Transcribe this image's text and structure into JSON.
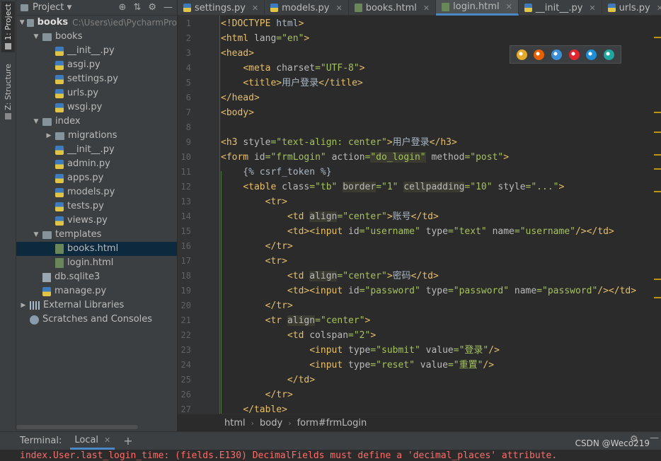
{
  "toolstrip": {
    "project_tab": "1: Project",
    "structure_tab": "Z: Structure"
  },
  "project_panel": {
    "title": "Project",
    "tree": [
      {
        "label": "books",
        "path": "C:\\Users\\ied\\PycharmPro",
        "type": "folder",
        "depth": 0,
        "expanded": true,
        "bold": true
      },
      {
        "label": "books",
        "type": "folder",
        "depth": 1,
        "expanded": true
      },
      {
        "label": "__init__.py",
        "type": "py",
        "depth": 2
      },
      {
        "label": "asgi.py",
        "type": "py",
        "depth": 2
      },
      {
        "label": "settings.py",
        "type": "py",
        "depth": 2
      },
      {
        "label": "urls.py",
        "type": "py",
        "depth": 2
      },
      {
        "label": "wsgi.py",
        "type": "py",
        "depth": 2
      },
      {
        "label": "index",
        "type": "folder",
        "depth": 1,
        "expanded": true
      },
      {
        "label": "migrations",
        "type": "folder",
        "depth": 2,
        "expanded": false
      },
      {
        "label": "__init__.py",
        "type": "py",
        "depth": 2
      },
      {
        "label": "admin.py",
        "type": "py",
        "depth": 2
      },
      {
        "label": "apps.py",
        "type": "py",
        "depth": 2
      },
      {
        "label": "models.py",
        "type": "py",
        "depth": 2
      },
      {
        "label": "tests.py",
        "type": "py",
        "depth": 2
      },
      {
        "label": "views.py",
        "type": "py",
        "depth": 2
      },
      {
        "label": "templates",
        "type": "folder",
        "depth": 1,
        "expanded": true
      },
      {
        "label": "books.html",
        "type": "html",
        "depth": 2,
        "selected": true
      },
      {
        "label": "login.html",
        "type": "html",
        "depth": 2
      },
      {
        "label": "db.sqlite3",
        "type": "db",
        "depth": 1
      },
      {
        "label": "manage.py",
        "type": "py",
        "depth": 1
      },
      {
        "label": "External Libraries",
        "type": "lib",
        "depth": 0,
        "expanded": false
      },
      {
        "label": "Scratches and Consoles",
        "type": "scratch",
        "depth": 0
      }
    ]
  },
  "editor_tabs": [
    {
      "label": "settings.py",
      "type": "py"
    },
    {
      "label": "models.py",
      "type": "py"
    },
    {
      "label": "books.html",
      "type": "html"
    },
    {
      "label": "login.html",
      "type": "html",
      "active": true
    },
    {
      "label": "__init__.py",
      "type": "py"
    },
    {
      "label": "urls.py",
      "type": "py"
    }
  ],
  "line_numbers": [
    "1",
    "2",
    "3",
    "4",
    "5",
    "6",
    "7",
    "8",
    "9",
    "10",
    "11",
    "12",
    "13",
    "14",
    "15",
    "16",
    "17",
    "18",
    "19",
    "20",
    "21",
    "22",
    "23",
    "24",
    "25",
    "26",
    "27"
  ],
  "code_lines": [
    "<!DOCTYPE html>",
    "<html lang=\"en\">",
    "<head>",
    "    <meta charset=\"UTF-8\">",
    "    <title>用户登录</title>",
    "</head>",
    "<body>",
    "",
    "<h3 style=\"text-align: center\">用户登录</h3>",
    "<form id=\"frmLogin\" action=\"do_login\" method=\"post\">",
    "    {% csrf_token %}",
    "    <table class=\"tb\" border=\"1\" cellpadding=\"10\" style=\"...\">",
    "        <tr>",
    "            <td align=\"center\">账号</td>",
    "            <td><input id=\"username\" type=\"text\" name=\"username\"/></td>",
    "        </tr>",
    "        <tr>",
    "            <td align=\"center\">密码</td>",
    "            <td><input id=\"password\" type=\"password\" name=\"password\"/></td>",
    "        </tr>",
    "        <tr align=\"center\">",
    "            <td colspan=\"2\">",
    "                <input type=\"submit\" value=\"登录\"/>",
    "                <input type=\"reset\" value=\"重置\"/>",
    "            </td>",
    "        </tr>",
    "    </table>"
  ],
  "browser_icons": [
    "chrome-icon",
    "firefox-icon",
    "safari-icon",
    "opera-icon",
    "ie-icon",
    "edge-icon"
  ],
  "breadcrumb": [
    "html",
    "body",
    "form#frmLogin"
  ],
  "terminal": {
    "title": "Terminal:",
    "tab_label": "Local",
    "output": "index.User.last_login_time: (fields.E130) DecimalFields must define a 'decimal_places' attribute."
  },
  "watermark": "CSDN @Weco219",
  "colors": {
    "tag": "#e8bf6a",
    "value": "#a5c25c",
    "accent": "#4a88c7",
    "error": "#ff6b68"
  }
}
